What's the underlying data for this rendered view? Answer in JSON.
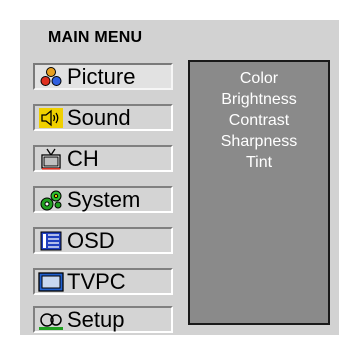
{
  "title": "MAIN MENU",
  "menu": [
    {
      "label": "Picture",
      "icon": "people-icon",
      "selected": true
    },
    {
      "label": "Sound",
      "icon": "speaker-icon",
      "selected": false
    },
    {
      "label": "CH",
      "icon": "tv-antenna-icon",
      "selected": false
    },
    {
      "label": "System",
      "icon": "gears-icon",
      "selected": false
    },
    {
      "label": "OSD",
      "icon": "list-icon",
      "selected": false
    },
    {
      "label": "TVPC",
      "icon": "monitor-icon",
      "selected": false
    },
    {
      "label": "Setup",
      "icon": "setup-icon",
      "selected": false
    }
  ],
  "submenu": [
    "Color",
    "Brightness",
    "Contrast",
    "Sharpness",
    "Tint"
  ],
  "colors": {
    "panel": "#d2d2d2",
    "submenu_bg": "#8a8a8a",
    "submenu_text": "#ffffff"
  }
}
